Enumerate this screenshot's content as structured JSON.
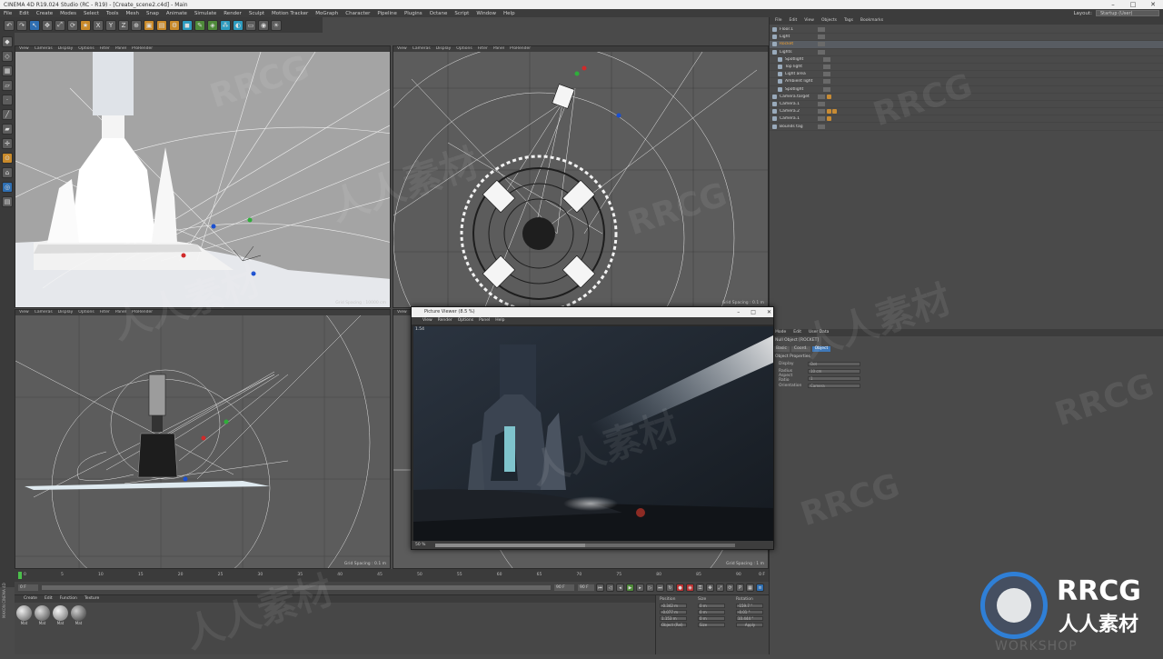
{
  "window": {
    "title": "CINEMA 4D R19.024 Studio (RC - R19) - [Create_scene2.c4d] - Main",
    "controls": [
      "–",
      "□",
      "✕"
    ]
  },
  "menu": {
    "items": [
      "File",
      "Edit",
      "Create",
      "Modes",
      "Select",
      "Tools",
      "Mesh",
      "Snap",
      "Animate",
      "Simulate",
      "Render",
      "Sculpt",
      "Motion Tracker",
      "MoGraph",
      "Character",
      "Pipeline",
      "Plugins",
      "Octane",
      "Script",
      "Window",
      "Help"
    ],
    "layout_label": "Layout:",
    "layout_value": "Startup (User)"
  },
  "viewports": {
    "top_left": {
      "menu": [
        "View",
        "Cameras",
        "Display",
        "Options",
        "Filter",
        "Panel",
        "ProRender"
      ],
      "label": "Perspective",
      "grid": "Grid Spacing : 10000 cm"
    },
    "top_right": {
      "menu": [
        "View",
        "Cameras",
        "Display",
        "Options",
        "Filter",
        "Panel",
        "ProRender"
      ],
      "label": "Top",
      "grid": "Grid Spacing : 0.1 m"
    },
    "bottom_left": {
      "menu": [
        "View",
        "Cameras",
        "Display",
        "Options",
        "Filter",
        "Panel",
        "ProRender"
      ],
      "label": "Right",
      "grid": "Grid Spacing : 0.1 m"
    },
    "bottom_right": {
      "menu": [
        "View"
      ],
      "label": "Front",
      "grid": "Grid Spacing : 1 m"
    }
  },
  "object_manager": {
    "menu": [
      "File",
      "Edit",
      "View",
      "Objects",
      "Tags",
      "Bookmarks"
    ],
    "objects": [
      {
        "name": "Floor.1",
        "tags": 0
      },
      {
        "name": "Light",
        "tags": 0
      },
      {
        "name": "Rocket",
        "tags": 0
      },
      {
        "name": "Lights",
        "tags": 0
      },
      {
        "name": "Spotlight",
        "tags": 0
      },
      {
        "name": "Top light",
        "tags": 0
      },
      {
        "name": "Light area",
        "tags": 0
      },
      {
        "name": "Ambient light",
        "tags": 0
      },
      {
        "name": "Spotlight",
        "tags": 0
      },
      {
        "name": "Camera.target",
        "tags": 1
      },
      {
        "name": "Camera.1",
        "tags": 0
      },
      {
        "name": "Camera.2",
        "tags": 2
      },
      {
        "name": "Camera.1",
        "tags": 1
      },
      {
        "name": "Bounds tag",
        "tags": 0
      }
    ]
  },
  "attribute_manager": {
    "menu": [
      "Mode",
      "Edit",
      "User Data"
    ],
    "object_label": "Null Object [ROCKET]",
    "tabs": [
      "Basic",
      "Coord.",
      "Object"
    ],
    "active_tab": "Object",
    "section": "Object Properties",
    "fields": [
      {
        "label": "Display",
        "value": "Dot"
      },
      {
        "label": "Radius",
        "value": "10 cm"
      },
      {
        "label": "Aspect Ratio",
        "value": "1"
      },
      {
        "label": "Orientation",
        "value": "Camera"
      }
    ]
  },
  "picture_viewer": {
    "title": "Picture Viewer (8.5 %)",
    "menu": [
      "View",
      "Render",
      "Options",
      "Panel",
      "Help"
    ],
    "info": "1.54",
    "zoom": "50 %"
  },
  "timeline": {
    "ticks": [
      "0",
      "5",
      "10",
      "15",
      "20",
      "25",
      "30",
      "35",
      "40",
      "45",
      "50",
      "55",
      "60",
      "65",
      "70",
      "75",
      "80",
      "85",
      "90"
    ],
    "frame_value": "0 F",
    "start": "0 F",
    "end": "90 F",
    "current": "90 F"
  },
  "material_manager": {
    "menu": [
      "Create",
      "Edit",
      "Function",
      "Texture"
    ],
    "materials": [
      "Mat",
      "Mat",
      "Mat",
      "Mat"
    ]
  },
  "coordinates": {
    "headers": [
      "Position",
      "Size",
      "Rotation"
    ],
    "rows": [
      {
        "axis": "X",
        "pos": "-0.342 m",
        "size": "0 m",
        "rot_label": "H",
        "rot": "-159.7 °"
      },
      {
        "axis": "Y",
        "pos": "-0.077 m",
        "size": "0 m",
        "rot_label": "P",
        "rot": "-0.01 °"
      },
      {
        "axis": "Z",
        "pos": "1.153 m",
        "size": "0 m",
        "rot_label": "B",
        "rot": "10.444 °"
      }
    ],
    "mode": "Object (Rel)",
    "size_mode": "Size",
    "apply": "Apply"
  },
  "watermarks": {
    "brand_latin": "RRCG",
    "brand_cn": "人人素材",
    "workshop": "WORKSHOP"
  },
  "maxon_label": "MAXON CINEMA 4D"
}
